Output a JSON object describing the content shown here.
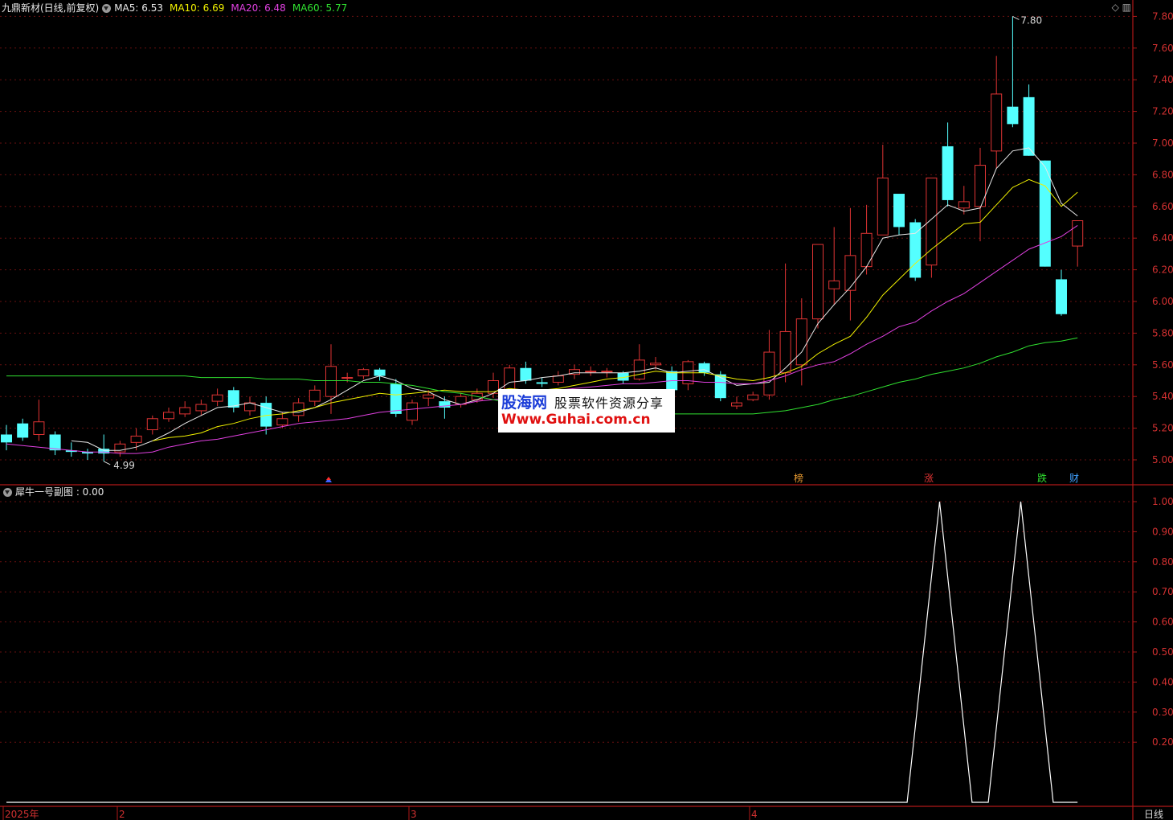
{
  "header": {
    "title": "九鼎新材(日线,前复权)",
    "ma": [
      {
        "label": "MA5: 6.53",
        "color": "#e8e8e8"
      },
      {
        "label": "MA10: 6.69",
        "color": "#f0f000"
      },
      {
        "label": "MA20: 6.48",
        "color": "#e040e0"
      },
      {
        "label": "MA60: 5.77",
        "color": "#30e030"
      }
    ]
  },
  "subheader": {
    "title": "犀牛一号副图 : 0.00"
  },
  "icons": {
    "top_right": "◇ ▥"
  },
  "watermark": {
    "line1": "股海网",
    "line1b": "股票软件资源分享",
    "line2": "Www.Guhai.com.cn"
  },
  "chart_data": [
    {
      "type": "candlestick",
      "title": "九鼎新材(日线,前复权)",
      "y_ticks": [
        "7.80",
        "7.60",
        "7.40",
        "7.20",
        "7.00",
        "6.80",
        "6.60",
        "6.40",
        "6.20",
        "6.00",
        "5.80",
        "5.60",
        "5.40",
        "5.20",
        "5.00"
      ],
      "ylim": [
        4.87,
        7.88
      ],
      "x_labels": [
        "2025年",
        "2",
        "3",
        "4"
      ],
      "annotations": {
        "high": "7.80",
        "low": "4.99",
        "signals": [
          "榜",
          "涨",
          "跌",
          "财"
        ]
      },
      "candles": [
        [
          5.16,
          5.11,
          5.06,
          5.22
        ],
        [
          5.23,
          5.14,
          5.12,
          5.26
        ],
        [
          5.16,
          5.24,
          5.12,
          5.38
        ],
        [
          5.16,
          5.06,
          5.03,
          5.18
        ],
        [
          5.06,
          5.05,
          5.02,
          5.11
        ],
        [
          5.05,
          5.04,
          5.0,
          5.07
        ],
        [
          5.07,
          5.04,
          4.99,
          5.16
        ],
        [
          5.05,
          5.1,
          5.02,
          5.12
        ],
        [
          5.11,
          5.15,
          5.06,
          5.2
        ],
        [
          5.19,
          5.26,
          5.16,
          5.28
        ],
        [
          5.26,
          5.3,
          5.24,
          5.33
        ],
        [
          5.29,
          5.33,
          5.27,
          5.37
        ],
        [
          5.31,
          5.35,
          5.28,
          5.38
        ],
        [
          5.37,
          5.41,
          5.34,
          5.45
        ],
        [
          5.44,
          5.33,
          5.3,
          5.46
        ],
        [
          5.31,
          5.36,
          5.28,
          5.4
        ],
        [
          5.36,
          5.21,
          5.16,
          5.4
        ],
        [
          5.22,
          5.26,
          5.2,
          5.3
        ],
        [
          5.28,
          5.36,
          5.24,
          5.39
        ],
        [
          5.37,
          5.44,
          5.34,
          5.47
        ],
        [
          5.4,
          5.59,
          5.29,
          5.73
        ],
        [
          5.52,
          5.52,
          5.49,
          5.55
        ],
        [
          5.53,
          5.57,
          5.51,
          5.58
        ],
        [
          5.57,
          5.53,
          5.5,
          5.58
        ],
        [
          5.48,
          5.29,
          5.27,
          5.51
        ],
        [
          5.25,
          5.36,
          5.22,
          5.38
        ],
        [
          5.39,
          5.41,
          5.34,
          5.44
        ],
        [
          5.37,
          5.33,
          5.26,
          5.4
        ],
        [
          5.35,
          5.4,
          5.33,
          5.42
        ],
        [
          5.38,
          5.42,
          5.36,
          5.45
        ],
        [
          5.42,
          5.5,
          5.39,
          5.55
        ],
        [
          5.44,
          5.58,
          5.41,
          5.6
        ],
        [
          5.58,
          5.5,
          5.48,
          5.62
        ],
        [
          5.49,
          5.48,
          5.46,
          5.52
        ],
        [
          5.49,
          5.53,
          5.47,
          5.56
        ],
        [
          5.54,
          5.57,
          5.51,
          5.6
        ],
        [
          5.56,
          5.56,
          5.53,
          5.59
        ],
        [
          5.56,
          5.56,
          5.52,
          5.58
        ],
        [
          5.55,
          5.5,
          5.48,
          5.56
        ],
        [
          5.51,
          5.63,
          5.5,
          5.73
        ],
        [
          5.6,
          5.61,
          5.57,
          5.65
        ],
        [
          5.56,
          5.44,
          5.42,
          5.59
        ],
        [
          5.48,
          5.62,
          5.44,
          5.63
        ],
        [
          5.61,
          5.55,
          5.53,
          5.62
        ],
        [
          5.54,
          5.39,
          5.37,
          5.56
        ],
        [
          5.34,
          5.36,
          5.32,
          5.4
        ],
        [
          5.38,
          5.41,
          5.37,
          5.43
        ],
        [
          5.41,
          5.68,
          5.38,
          5.82
        ],
        [
          5.55,
          5.81,
          5.49,
          6.24
        ],
        [
          5.6,
          5.89,
          5.47,
          6.02
        ],
        [
          5.89,
          6.36,
          5.83,
          6.36
        ],
        [
          6.08,
          6.13,
          5.98,
          6.47
        ],
        [
          6.07,
          6.29,
          5.88,
          6.59
        ],
        [
          6.22,
          6.43,
          6.17,
          6.61
        ],
        [
          6.42,
          6.78,
          6.46,
          6.99
        ],
        [
          6.68,
          6.47,
          6.42,
          6.67
        ],
        [
          6.5,
          6.15,
          6.13,
          6.52
        ],
        [
          6.23,
          6.78,
          6.15,
          6.78
        ],
        [
          6.98,
          6.64,
          6.6,
          7.13
        ],
        [
          6.59,
          6.63,
          6.55,
          6.73
        ],
        [
          6.6,
          6.86,
          6.38,
          6.97
        ],
        [
          6.95,
          7.31,
          6.84,
          7.55
        ],
        [
          7.23,
          7.12,
          7.1,
          7.8
        ],
        [
          7.29,
          6.92,
          6.92,
          7.37
        ],
        [
          6.89,
          6.22,
          6.22,
          6.89
        ],
        [
          6.14,
          5.92,
          5.91,
          6.2
        ],
        [
          6.35,
          6.51,
          6.22,
          6.51
        ]
      ],
      "series": [
        {
          "name": "MA5",
          "color": "#e8e8e8",
          "values": [
            null,
            null,
            null,
            null,
            5.12,
            5.11,
            5.06,
            5.06,
            5.08,
            5.12,
            5.17,
            5.23,
            5.28,
            5.33,
            5.34,
            5.36,
            5.33,
            5.3,
            5.3,
            5.33,
            5.38,
            5.44,
            5.5,
            5.53,
            5.5,
            5.45,
            5.43,
            5.38,
            5.35,
            5.38,
            5.42,
            5.49,
            5.5,
            5.52,
            5.53,
            5.55,
            5.55,
            5.55,
            5.55,
            5.56,
            5.58,
            5.55,
            5.56,
            5.57,
            5.52,
            5.47,
            5.48,
            5.49,
            5.58,
            5.68,
            5.86,
            5.98,
            6.09,
            6.22,
            6.4,
            6.42,
            6.43,
            6.52,
            6.61,
            6.57,
            6.59,
            6.84,
            6.95,
            6.97,
            6.85,
            6.62,
            6.54
          ]
        },
        {
          "name": "MA10",
          "color": "#f0f000",
          "values": [
            null,
            null,
            null,
            null,
            null,
            null,
            null,
            null,
            null,
            5.12,
            5.14,
            5.15,
            5.17,
            5.21,
            5.23,
            5.26,
            5.28,
            5.29,
            5.31,
            5.33,
            5.36,
            5.38,
            5.4,
            5.42,
            5.41,
            5.42,
            5.43,
            5.44,
            5.43,
            5.43,
            5.43,
            5.45,
            5.44,
            5.44,
            5.45,
            5.47,
            5.49,
            5.51,
            5.52,
            5.54,
            5.56,
            5.55,
            5.55,
            5.55,
            5.53,
            5.51,
            5.5,
            5.52,
            5.55,
            5.59,
            5.67,
            5.73,
            5.78,
            5.9,
            6.04,
            6.14,
            6.24,
            6.33,
            6.41,
            6.49,
            6.5,
            6.61,
            6.72,
            6.77,
            6.73,
            6.6,
            6.69
          ]
        },
        {
          "name": "MA20",
          "color": "#e040e0",
          "values": [
            5.1,
            5.09,
            5.08,
            5.07,
            5.06,
            5.05,
            5.05,
            5.04,
            5.04,
            5.05,
            5.08,
            5.1,
            5.12,
            5.13,
            5.15,
            5.17,
            5.19,
            5.21,
            5.23,
            5.24,
            5.25,
            5.26,
            5.28,
            5.3,
            5.31,
            5.32,
            5.33,
            5.34,
            5.35,
            5.37,
            5.38,
            5.39,
            5.41,
            5.42,
            5.44,
            5.45,
            5.46,
            5.47,
            5.48,
            5.48,
            5.49,
            5.5,
            5.5,
            5.49,
            5.49,
            5.48,
            5.48,
            5.5,
            5.53,
            5.57,
            5.6,
            5.62,
            5.67,
            5.73,
            5.78,
            5.84,
            5.87,
            5.94,
            6.0,
            6.05,
            6.12,
            6.19,
            6.26,
            6.33,
            6.37,
            6.41,
            6.48
          ]
        },
        {
          "name": "MA60",
          "color": "#30e030",
          "values": [
            5.53,
            5.53,
            5.53,
            5.53,
            5.53,
            5.53,
            5.53,
            5.53,
            5.53,
            5.53,
            5.53,
            5.53,
            5.52,
            5.52,
            5.52,
            5.52,
            5.51,
            5.51,
            5.51,
            5.5,
            5.5,
            5.5,
            5.49,
            5.49,
            5.48,
            5.47,
            5.45,
            5.43,
            5.42,
            5.4,
            5.38,
            5.36,
            5.34,
            5.33,
            5.31,
            5.3,
            5.29,
            5.29,
            5.29,
            5.29,
            5.29,
            5.29,
            5.29,
            5.29,
            5.29,
            5.29,
            5.29,
            5.3,
            5.31,
            5.33,
            5.35,
            5.38,
            5.4,
            5.43,
            5.46,
            5.49,
            5.51,
            5.54,
            5.56,
            5.58,
            5.61,
            5.65,
            5.68,
            5.72,
            5.74,
            5.75,
            5.77
          ]
        }
      ]
    },
    {
      "type": "line",
      "title": "犀牛一号副图",
      "y_ticks": [
        "1.00",
        "0.90",
        "0.80",
        "0.70",
        "0.60",
        "0.50",
        "0.40",
        "0.30",
        "0.20"
      ],
      "ylim": [
        0,
        1
      ],
      "series": [
        {
          "color": "#ffffff",
          "points": [
            [
              0,
              0
            ],
            [
              55.5,
              0
            ],
            [
              57.5,
              1
            ],
            [
              59.5,
              0
            ],
            [
              60.5,
              0
            ],
            [
              62.5,
              1
            ],
            [
              64.5,
              0
            ],
            [
              66,
              0
            ]
          ]
        }
      ]
    }
  ]
}
